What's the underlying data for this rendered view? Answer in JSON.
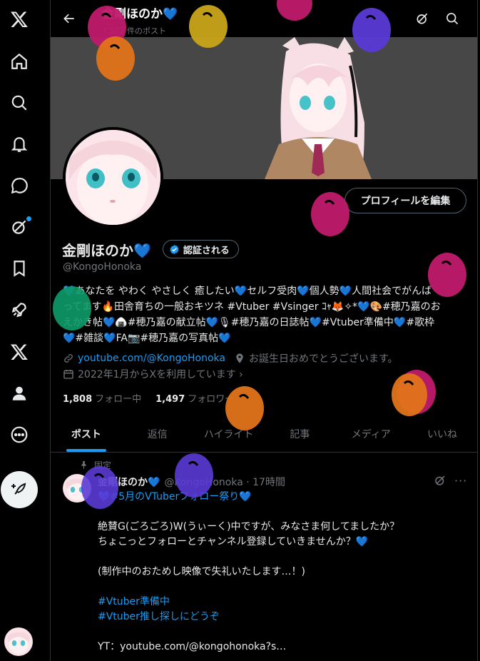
{
  "sidebar": {
    "items": [
      {
        "name": "x-logo-icon"
      },
      {
        "name": "home-icon"
      },
      {
        "name": "explore-icon"
      },
      {
        "name": "notifications-icon"
      },
      {
        "name": "messages-icon"
      },
      {
        "name": "grok-icon"
      },
      {
        "name": "bookmarks-icon"
      },
      {
        "name": "rocket-icon"
      },
      {
        "name": "premium-x-icon"
      },
      {
        "name": "profile-icon"
      },
      {
        "name": "more-icon"
      }
    ],
    "compose_icon": "feather-plus-icon"
  },
  "header": {
    "title": "金剛ほのか💙",
    "post_count": "7,522 件のポスト"
  },
  "profile": {
    "edit_button": "プロフィールを編集",
    "display_name": "金剛ほのか💙",
    "verified_label": "認証される",
    "handle": "@KongoHonoka",
    "bio_lines": [
      "💙あなたを やわく やさしく 癒したい💙セルフ受肉💙個人勢💙人間社会でがんば",
      "ってます🔥田舎育ちの一般おキツネ #Vtuber #Vsinger ｺｬ🦊✧*💙🎨#穂乃嘉のお",
      "えかき帖💙🍙#穂乃嘉の献立帖💙🎙#穂乃嘉の日誌帖💙#Vtuber準備中💙#歌枠",
      "💙#雑談💙FA📷#穂乃嘉の写真帖💙"
    ],
    "website": "youtube.com/@KongoHonoka",
    "birthday": "お誕生日おめでとうございます。",
    "joined": "2022年1月からXを利用しています ›",
    "following_count": "1,808",
    "following_label": "フォロー中",
    "followers_count": "1,497",
    "followers_label": "フォロワー"
  },
  "tabs": [
    "ポスト",
    "返信",
    "ハイライト",
    "記事",
    "メディア",
    "いいね"
  ],
  "post": {
    "pinned_label": "固定",
    "author": "金剛ほのか💙",
    "handle_time": "@KongoHonoka · 17時間",
    "lines": [
      "💙#5月のVTuberフォロー祭り💙",
      "",
      "絶賛G(ごろごろ)W(うぃーく)中ですが、みなさま何してましたか？",
      "ちょこっとフォローとチャンネル登録していきませんか？💙",
      "",
      "(制作中のおためし映像で失礼いたします…！)",
      "",
      "#Vtuber準備中",
      "#Vtuber推し探しにどうぞ",
      "",
      "YT：youtube.com/@kongohonoka?s…"
    ]
  },
  "colors": {
    "accent": "#1d9bf0",
    "heart": "#7cc4f5",
    "background": "#000000",
    "muted": "#71767b"
  }
}
